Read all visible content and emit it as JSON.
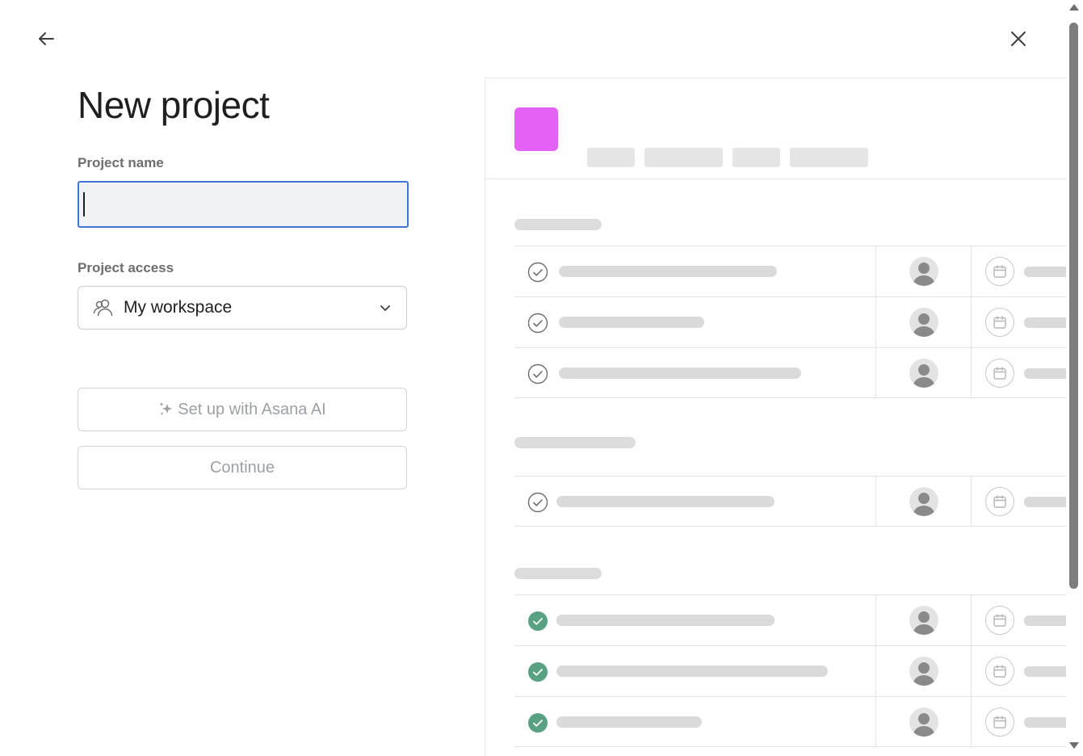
{
  "nav": {
    "back_icon": "arrow-left-icon",
    "close_icon": "close-icon"
  },
  "form": {
    "title": "New project",
    "project_name_label": "Project name",
    "project_name_value": "",
    "project_access_label": "Project access",
    "project_access_value": "My workspace",
    "project_access_icon": "team-icon",
    "ai_button_label": "Set up with Asana AI",
    "continue_button_label": "Continue"
  },
  "preview": {
    "project_color": "#e362f5",
    "completed_check_color": "#58a182"
  },
  "colors": {
    "focus_border": "#4573d2",
    "disabled_text": "#9ca0a4"
  }
}
